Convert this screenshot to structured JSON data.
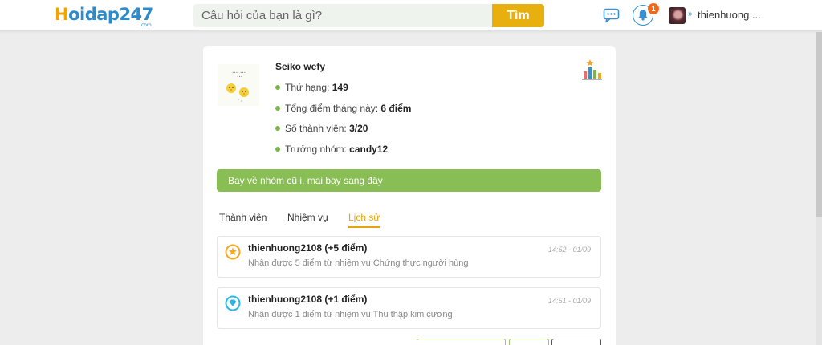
{
  "header": {
    "logo_h": "H",
    "logo_rest": "oidap247",
    "logo_sub": ".com",
    "search_placeholder": "Câu hỏi của bạn là gì?",
    "search_button": "Tìm",
    "notification_count": "1",
    "username": "thienhuong ..."
  },
  "team": {
    "name": "Seiko wefy",
    "info": [
      {
        "label": "Thứ hạng: ",
        "value": "149"
      },
      {
        "label": "Tổng điểm tháng này: ",
        "value": "6 điểm"
      },
      {
        "label": "Số thành viên: ",
        "value": "3/20"
      },
      {
        "label": "Trưởng nhóm: ",
        "value": "candy12"
      }
    ],
    "banner": "Bay về nhóm cũ i, mai bay sang đây"
  },
  "tabs": [
    {
      "label": "Thành viên",
      "active": false
    },
    {
      "label": "Nhiệm vụ",
      "active": false
    },
    {
      "label": "Lịch sử",
      "active": true
    }
  ],
  "history": [
    {
      "title": "thienhuong2108 (+5 điểm)",
      "desc": "Nhận được 5 điểm từ nhiệm vụ Chứng thực người hùng",
      "time": "14:52 - 01/09",
      "icon": "star-badge-icon",
      "color": "#f5a623"
    },
    {
      "title": "thienhuong2108 (+1 điểm)",
      "desc": "Nhận được 1 điểm từ nhiệm vụ Thu thập kim cương",
      "time": "14:51 - 01/09",
      "icon": "diamond-badge-icon",
      "color": "#29b6e8"
    }
  ],
  "colors": {
    "accent": "#e8b00f",
    "brand_blue": "#2e8bc9",
    "banner_green": "#88be53",
    "dot_green": "#7ab648"
  }
}
